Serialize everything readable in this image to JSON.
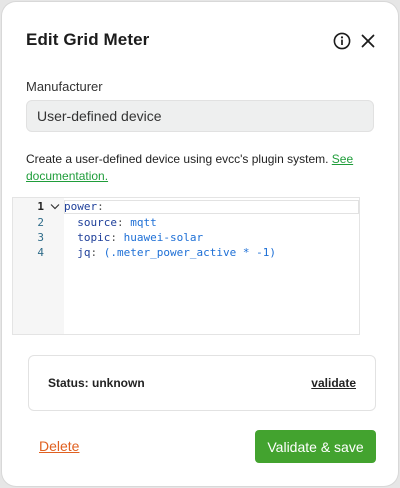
{
  "modal": {
    "title": "Edit Grid Meter",
    "info_icon": "info-circle-icon",
    "close_icon": "close-x-icon"
  },
  "manufacturer": {
    "label": "Manufacturer",
    "value": "User-defined device"
  },
  "description": {
    "text": "Create a user-defined device using evcc's plugin system. ",
    "link_text": "See documentation."
  },
  "editor": {
    "fold_icon": "chevron-down-icon",
    "lines": [
      {
        "number": "1",
        "indent": "",
        "key": "power",
        "sep": ":",
        "value": ""
      },
      {
        "number": "2",
        "indent": "  ",
        "key": "source",
        "sep": ": ",
        "value": "mqtt"
      },
      {
        "number": "3",
        "indent": "  ",
        "key": "topic",
        "sep": ": ",
        "value": "huawei-solar"
      },
      {
        "number": "4",
        "indent": "  ",
        "key": "jq",
        "sep": ": ",
        "value": "(.meter_power_active * -1)"
      }
    ]
  },
  "status": {
    "text": "Status: unknown",
    "validate_label": "validate"
  },
  "footer": {
    "delete_label": "Delete",
    "save_label": "Validate & save"
  },
  "colors": {
    "primary_button": "#43a32f",
    "delete_link": "#e06020",
    "doc_link": "#1f9d3a"
  }
}
